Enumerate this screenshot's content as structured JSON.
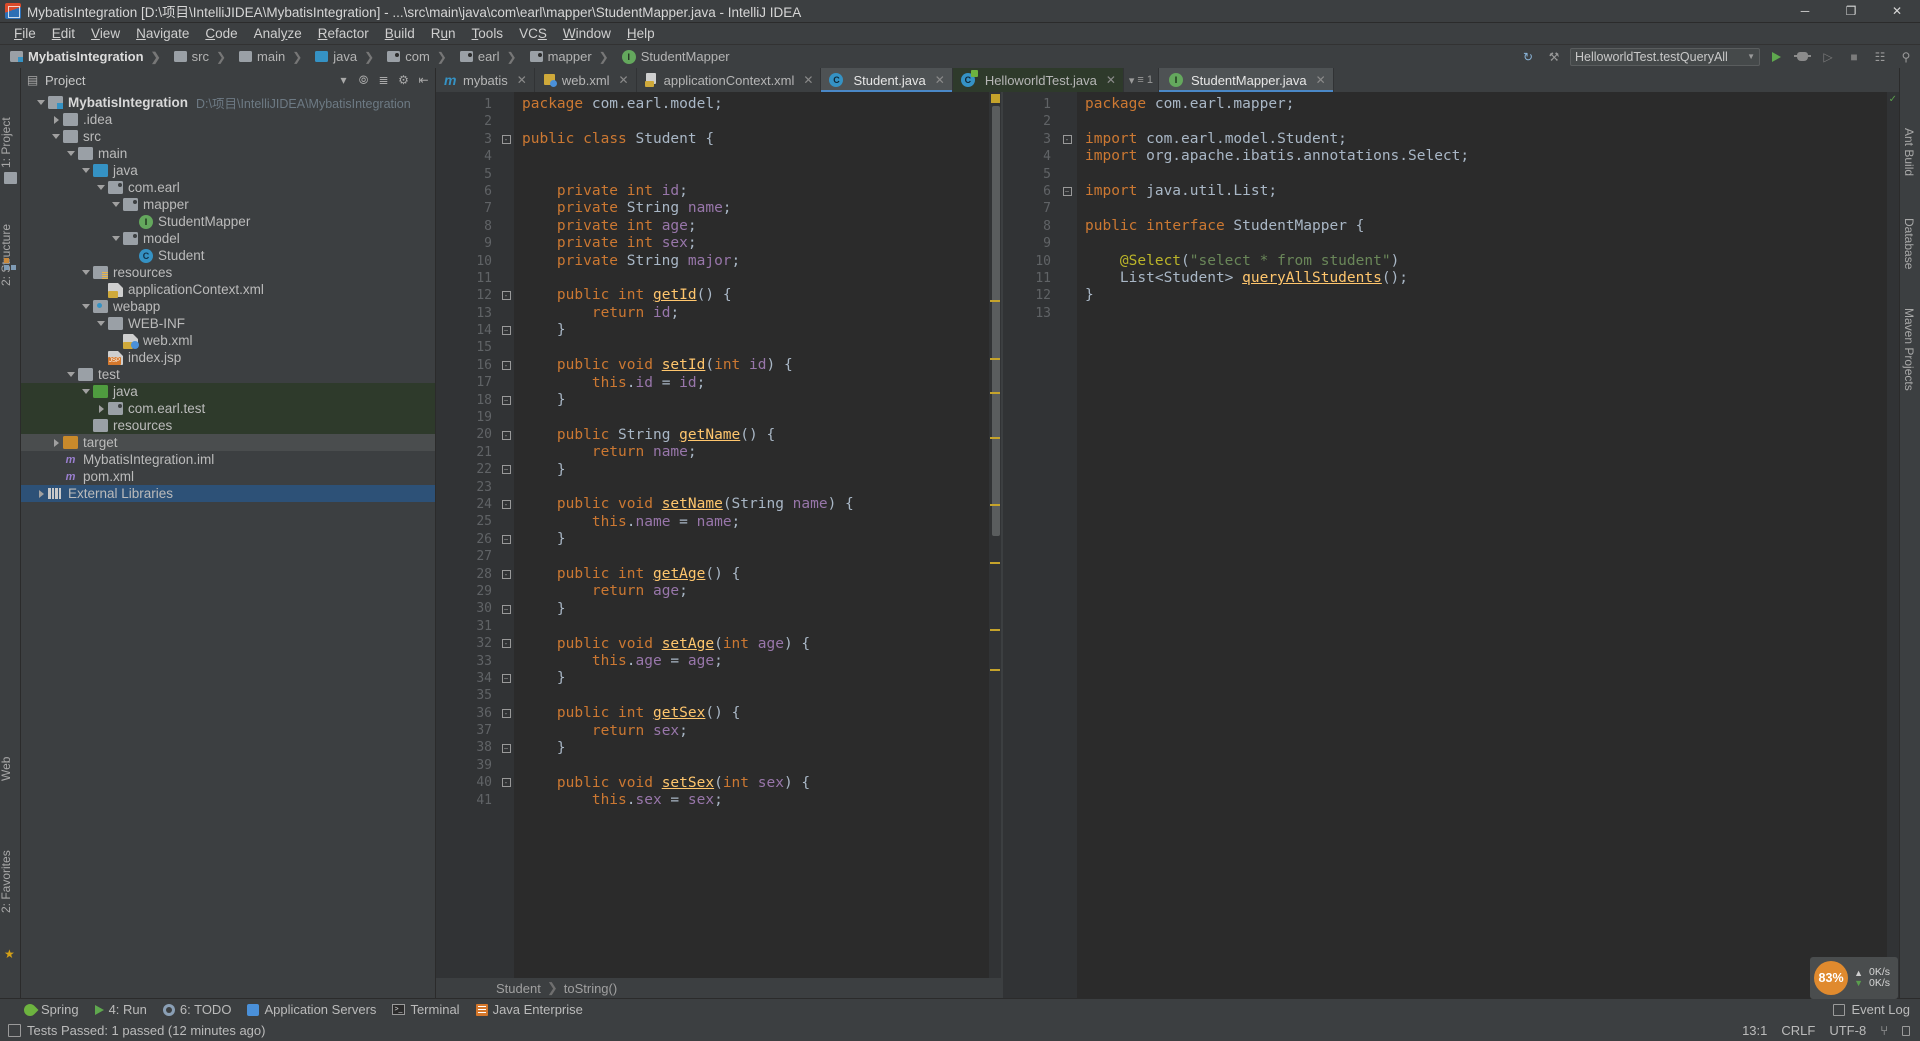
{
  "window": {
    "title": "MybatisIntegration [D:\\项目\\IntelliJIDEA\\MybatisIntegration] - ...\\src\\main\\java\\com\\earl\\mapper\\StudentMapper.java - IntelliJ IDEA",
    "app_icon": "intellij-idea-icon",
    "minimize": "─",
    "maximize": "❐",
    "close": "✕"
  },
  "menu": [
    {
      "label": "File"
    },
    {
      "label": "Edit"
    },
    {
      "label": "View"
    },
    {
      "label": "Navigate"
    },
    {
      "label": "Code"
    },
    {
      "label": "Analyze"
    },
    {
      "label": "Refactor"
    },
    {
      "label": "Build"
    },
    {
      "label": "Run"
    },
    {
      "label": "Tools"
    },
    {
      "label": "VCS"
    },
    {
      "label": "Window"
    },
    {
      "label": "Help"
    }
  ],
  "breadcrumb": [
    {
      "label": "MybatisIntegration",
      "icon": "module-icon"
    },
    {
      "label": "src",
      "icon": "folder-icon"
    },
    {
      "label": "main",
      "icon": "folder-icon"
    },
    {
      "label": "java",
      "icon": "source-folder-icon"
    },
    {
      "label": "com",
      "icon": "package-icon"
    },
    {
      "label": "earl",
      "icon": "package-icon"
    },
    {
      "label": "mapper",
      "icon": "package-icon"
    },
    {
      "label": "StudentMapper",
      "icon": "interface-icon"
    }
  ],
  "toolbar": {
    "run_config": "HelloworldTest.testQueryAll",
    "run_button": "run-button",
    "debug_button": "debug-button",
    "coverage_button": "run-with-coverage-button",
    "layout_button": "restore-layout-button",
    "search_button": "search-everywhere-button"
  },
  "project_panel": {
    "title": "Project",
    "icons": [
      "locate-icon",
      "collapse-all-icon",
      "settings-icon",
      "hide-icon"
    ],
    "tree": [
      {
        "label": "MybatisIntegration",
        "path": "D:\\项目\\IntelliJIDEA\\MybatisIntegration",
        "depth": 0,
        "arrow": "down",
        "icon": "module-icon",
        "bold": true,
        "state": "none"
      },
      {
        "label": ".idea",
        "depth": 1,
        "arrow": "right",
        "icon": "folder-grey",
        "state": "none"
      },
      {
        "label": "src",
        "depth": 1,
        "arrow": "down",
        "icon": "folder-grey",
        "state": "none"
      },
      {
        "label": "main",
        "depth": 2,
        "arrow": "down",
        "icon": "folder-grey",
        "state": "none"
      },
      {
        "label": "java",
        "depth": 3,
        "arrow": "down",
        "icon": "folder-blue",
        "state": "none"
      },
      {
        "label": "com.earl",
        "depth": 4,
        "arrow": "down",
        "icon": "package-icon",
        "state": "none"
      },
      {
        "label": "mapper",
        "depth": 5,
        "arrow": "down",
        "icon": "package-icon",
        "state": "none"
      },
      {
        "label": "StudentMapper",
        "depth": 6,
        "arrow": "none",
        "icon": "interface-icon",
        "state": "none"
      },
      {
        "label": "model",
        "depth": 5,
        "arrow": "down",
        "icon": "package-icon",
        "state": "none"
      },
      {
        "label": "Student",
        "depth": 6,
        "arrow": "none",
        "icon": "class-icon",
        "state": "none"
      },
      {
        "label": "resources",
        "depth": 3,
        "arrow": "down",
        "icon": "resources-folder-icon",
        "state": "none"
      },
      {
        "label": "applicationContext.xml",
        "depth": 4,
        "arrow": "none",
        "icon": "xml-file-icon",
        "state": "none"
      },
      {
        "label": "webapp",
        "depth": 3,
        "arrow": "down",
        "icon": "webapp-folder-icon",
        "state": "none"
      },
      {
        "label": "WEB-INF",
        "depth": 4,
        "arrow": "down",
        "icon": "folder-grey",
        "state": "none"
      },
      {
        "label": "web.xml",
        "depth": 5,
        "arrow": "none",
        "icon": "web-xml-icon",
        "state": "none"
      },
      {
        "label": "index.jsp",
        "depth": 4,
        "arrow": "none",
        "icon": "jsp-file-icon",
        "state": "none"
      },
      {
        "label": "test",
        "depth": 2,
        "arrow": "down",
        "icon": "folder-grey",
        "state": "none"
      },
      {
        "label": "java",
        "depth": 3,
        "arrow": "down",
        "icon": "test-source-folder-icon",
        "state": "green"
      },
      {
        "label": "com.earl.test",
        "depth": 4,
        "arrow": "right",
        "icon": "package-icon",
        "state": "green"
      },
      {
        "label": "resources",
        "depth": 3,
        "arrow": "none",
        "icon": "folder-grey",
        "state": "green"
      },
      {
        "label": "target",
        "depth": 1,
        "arrow": "right",
        "icon": "folder-orange",
        "state": "grey"
      },
      {
        "label": "MybatisIntegration.iml",
        "depth": 1,
        "arrow": "none",
        "icon": "iml-file-icon",
        "state": "none"
      },
      {
        "label": "pom.xml",
        "depth": 1,
        "arrow": "none",
        "icon": "maven-pom-icon",
        "state": "none"
      },
      {
        "label": "External Libraries",
        "depth": 0,
        "arrow": "right",
        "icon": "libraries-icon",
        "state": "blue"
      }
    ]
  },
  "left_rail": [
    {
      "label": "1: Project",
      "icon": "project-icon"
    },
    {
      "label": "2: Structure",
      "icon": "structure-icon"
    },
    {
      "label": "Web",
      "icon": "web-icon"
    },
    {
      "label": "2: Favorites",
      "icon": "favorites-icon"
    }
  ],
  "right_rail": [
    {
      "label": "Ant Build",
      "icon": "ant-build-icon"
    },
    {
      "label": "Database",
      "icon": "database-icon"
    },
    {
      "label": "Maven Projects",
      "icon": "maven-icon"
    }
  ],
  "editor_tabs": [
    {
      "label": "mybatis",
      "icon": "mybatis-icon",
      "active": false,
      "closable": true
    },
    {
      "label": "web.xml",
      "icon": "web-xml-icon",
      "active": false,
      "closable": true
    },
    {
      "label": "applicationContext.xml",
      "icon": "xml-file-icon",
      "active": false,
      "closable": true
    },
    {
      "label": "Student.java",
      "icon": "class-icon",
      "active": true,
      "closable": true
    },
    {
      "label": "HelloworldTest.java",
      "icon": "test-class-icon",
      "active": false,
      "closable": true,
      "green": true
    },
    {
      "label": "StudentMapper.java",
      "icon": "interface-icon",
      "active": true,
      "closable": true
    }
  ],
  "tabs_overflow": "1",
  "left_editor": {
    "file": "Student.java",
    "breadcrumb": [
      "Student",
      "toString()"
    ],
    "first_line": 1,
    "lines": [
      {
        "n": 1,
        "text": "package com.earl.model;"
      },
      {
        "n": 2,
        "text": ""
      },
      {
        "n": 3,
        "text": "public class Student {"
      },
      {
        "n": 4,
        "text": ""
      },
      {
        "n": 5,
        "text": ""
      },
      {
        "n": 6,
        "text": "    private int id;"
      },
      {
        "n": 7,
        "text": "    private String name;"
      },
      {
        "n": 8,
        "text": "    private int age;"
      },
      {
        "n": 9,
        "text": "    private int sex;"
      },
      {
        "n": 10,
        "text": "    private String major;"
      },
      {
        "n": 11,
        "text": ""
      },
      {
        "n": 12,
        "text": "    public int getId() {"
      },
      {
        "n": 13,
        "text": "        return id;"
      },
      {
        "n": 14,
        "text": "    }"
      },
      {
        "n": 15,
        "text": ""
      },
      {
        "n": 16,
        "text": "    public void setId(int id) {"
      },
      {
        "n": 17,
        "text": "        this.id = id;"
      },
      {
        "n": 18,
        "text": "    }"
      },
      {
        "n": 19,
        "text": ""
      },
      {
        "n": 20,
        "text": "    public String getName() {"
      },
      {
        "n": 21,
        "text": "        return name;"
      },
      {
        "n": 22,
        "text": "    }"
      },
      {
        "n": 23,
        "text": ""
      },
      {
        "n": 24,
        "text": "    public void setName(String name) {"
      },
      {
        "n": 25,
        "text": "        this.name = name;"
      },
      {
        "n": 26,
        "text": "    }"
      },
      {
        "n": 27,
        "text": ""
      },
      {
        "n": 28,
        "text": "    public int getAge() {"
      },
      {
        "n": 29,
        "text": "        return age;"
      },
      {
        "n": 30,
        "text": "    }"
      },
      {
        "n": 31,
        "text": ""
      },
      {
        "n": 32,
        "text": "    public void setAge(int age) {"
      },
      {
        "n": 33,
        "text": "        this.age = age;"
      },
      {
        "n": 34,
        "text": "    }"
      },
      {
        "n": 35,
        "text": ""
      },
      {
        "n": 36,
        "text": "    public int getSex() {"
      },
      {
        "n": 37,
        "text": "        return sex;"
      },
      {
        "n": 38,
        "text": "    }"
      },
      {
        "n": 39,
        "text": ""
      },
      {
        "n": 40,
        "text": "    public void setSex(int sex) {"
      },
      {
        "n": 41,
        "text": "        this.sex = sex;"
      }
    ]
  },
  "right_editor": {
    "file": "StudentMapper.java",
    "lines": [
      {
        "n": 1,
        "text": "package com.earl.mapper;"
      },
      {
        "n": 2,
        "text": ""
      },
      {
        "n": 3,
        "text": "import com.earl.model.Student;"
      },
      {
        "n": 4,
        "text": "import org.apache.ibatis.annotations.Select;"
      },
      {
        "n": 5,
        "text": ""
      },
      {
        "n": 6,
        "text": "import java.util.List;"
      },
      {
        "n": 7,
        "text": ""
      },
      {
        "n": 8,
        "text": "public interface StudentMapper {"
      },
      {
        "n": 9,
        "text": ""
      },
      {
        "n": 10,
        "text": "    @Select(\"select * from student\")"
      },
      {
        "n": 11,
        "text": "    List<Student> queryAllStudents();"
      },
      {
        "n": 12,
        "text": "}"
      },
      {
        "n": 13,
        "text": ""
      }
    ]
  },
  "network_widget": {
    "percent": "83%",
    "up_speed": "0K/s",
    "down_speed": "0K/s"
  },
  "tool_window_bar": [
    {
      "label": "Spring",
      "icon": "spring-icon"
    },
    {
      "label": "4: Run",
      "icon": "run-icon"
    },
    {
      "label": "6: TODO",
      "icon": "todo-icon"
    },
    {
      "label": "Application Servers",
      "icon": "application-servers-icon"
    },
    {
      "label": "Terminal",
      "icon": "terminal-icon"
    },
    {
      "label": "Java Enterprise",
      "icon": "java-enterprise-icon"
    }
  ],
  "event_log": "Event Log",
  "status_bar": {
    "message": "Tests Passed: 1 passed (12 minutes ago)",
    "caret": "13:1",
    "line_sep": "CRLF",
    "encoding": "UTF-8",
    "indent": "⑂",
    "lock": "lock-icon"
  }
}
